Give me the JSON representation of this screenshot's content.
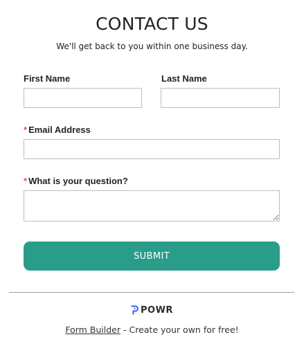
{
  "header": {
    "title": "CONTACT US",
    "subtitle": "We'll get back to you within one business day."
  },
  "fields": {
    "first_name": {
      "label": "First Name",
      "value": "",
      "required": false
    },
    "last_name": {
      "label": "Last Name",
      "value": "",
      "required": false
    },
    "email": {
      "label": "Email Address",
      "value": "",
      "required": true,
      "required_marker": "*"
    },
    "question": {
      "label": "What is your question?",
      "value": "",
      "required": true,
      "required_marker": "*"
    }
  },
  "submit": {
    "label": "SUBMIT",
    "color": "#2a9d8a"
  },
  "footer": {
    "brand": "POWR",
    "link_text": "Form Builder",
    "tagline": " - Create your own for free!"
  },
  "colors": {
    "accent": "#2a9d8a",
    "required": "#e05a4f",
    "brand_icon": "#4a6cf7"
  }
}
